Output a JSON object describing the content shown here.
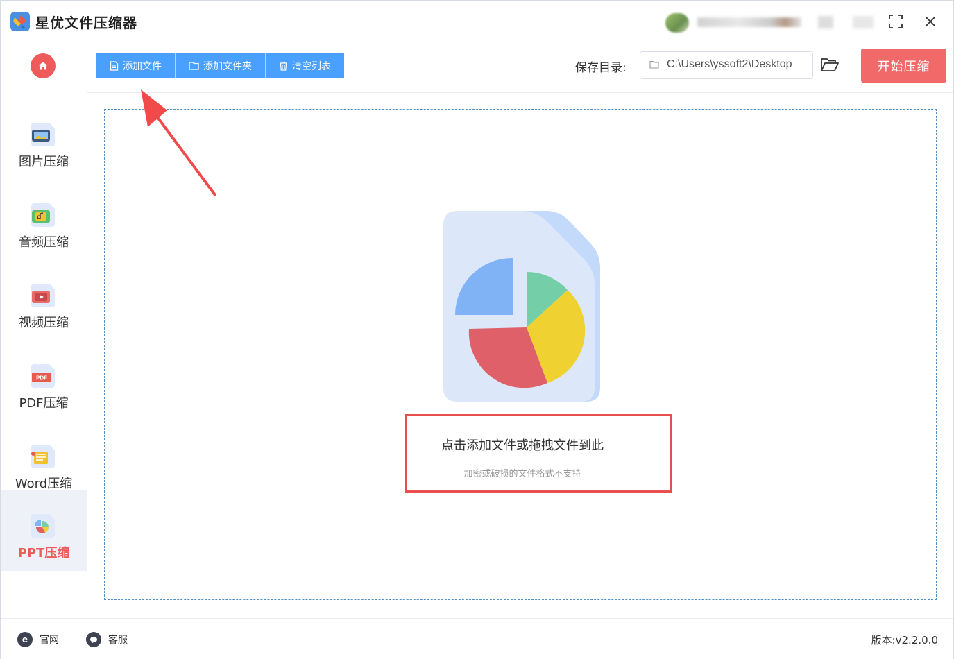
{
  "app": {
    "title": "星优文件压缩器"
  },
  "sidebar": {
    "home_icon": "home-icon",
    "items": [
      {
        "label": "图片压缩",
        "icon": "image-icon",
        "active": false
      },
      {
        "label": "音频压缩",
        "icon": "audio-icon",
        "active": false
      },
      {
        "label": "视频压缩",
        "icon": "video-icon",
        "active": false
      },
      {
        "label": "PDF压缩",
        "icon": "pdf-icon",
        "active": false
      },
      {
        "label": "Word压缩",
        "icon": "word-icon",
        "active": false
      },
      {
        "label": "PPT压缩",
        "icon": "ppt-icon",
        "active": true
      }
    ]
  },
  "toolbar": {
    "add_file": "添加文件",
    "add_folder": "添加文件夹",
    "clear_list": "清空列表",
    "save_label": "保存目录:",
    "save_path": "C:\\Users\\yssoft2\\Desktop",
    "start": "开始压缩"
  },
  "dropzone": {
    "title": "点击添加文件或拖拽文件到此",
    "subtitle": "加密或破损的文件格式不支持"
  },
  "footer": {
    "website": "官网",
    "support": "客服",
    "version": "版本:v2.2.0.0"
  },
  "colors": {
    "accent_blue": "#4aa0ff",
    "accent_red": "#f26969",
    "active_text": "#ef5b5b",
    "dashed_border": "#4d90c9",
    "highlight_border": "#e8504f"
  }
}
